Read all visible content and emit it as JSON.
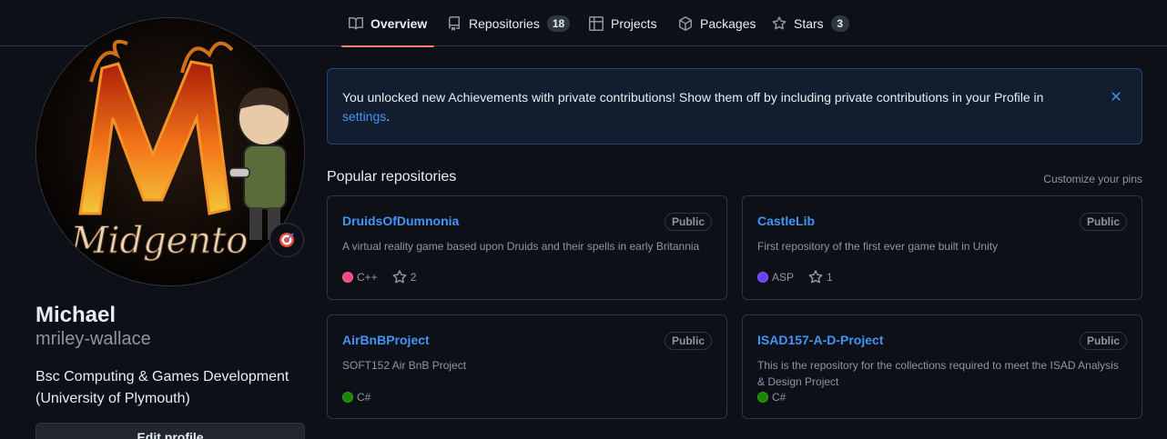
{
  "nav": {
    "tabs": [
      {
        "label": "Overview",
        "icon": "book-icon"
      },
      {
        "label": "Repositories",
        "icon": "repo-icon",
        "count": "18"
      },
      {
        "label": "Projects",
        "icon": "table-icon"
      },
      {
        "label": "Packages",
        "icon": "package-icon"
      },
      {
        "label": "Stars",
        "icon": "star-icon",
        "count": "3"
      }
    ],
    "accent": "#f78166"
  },
  "profile": {
    "name": "Michael",
    "login": "mriley-wallace",
    "bio_line1": "Bsc Computing & Games Development",
    "bio_line2": "(University of Plymouth)",
    "edit_label": "Edit profile",
    "avatar_text": "Midgento",
    "status_icon": "target-emoji-icon"
  },
  "flash": {
    "text": "You unlocked new Achievements with private contributions! Show them off by including private contributions in your Profile in",
    "link": "settings",
    "tail": "."
  },
  "popular": {
    "title": "Popular repositories",
    "customize": "Customize your pins",
    "repos": [
      {
        "name": "DruidsOfDumnonia",
        "visibility": "Public",
        "description": "A virtual reality game based upon Druids and their spells in early Britannia",
        "language": "C++",
        "lang_color": "#f34b7d",
        "stars": "2"
      },
      {
        "name": "CastleLib",
        "visibility": "Public",
        "description": "First repository of the first ever game built in Unity",
        "language": "ASP",
        "lang_color": "#6a40fd",
        "stars": "1"
      },
      {
        "name": "AirBnBProject",
        "visibility": "Public",
        "description": "SOFT152 Air BnB Project",
        "language": "C#",
        "lang_color": "#178600",
        "stars": ""
      },
      {
        "name": "ISAD157-A-D-Project",
        "visibility": "Public",
        "description": "This is the repository for the collections required to meet the ISAD Analysis & Design Project",
        "language": "C#",
        "lang_color": "#178600",
        "stars": ""
      }
    ]
  }
}
